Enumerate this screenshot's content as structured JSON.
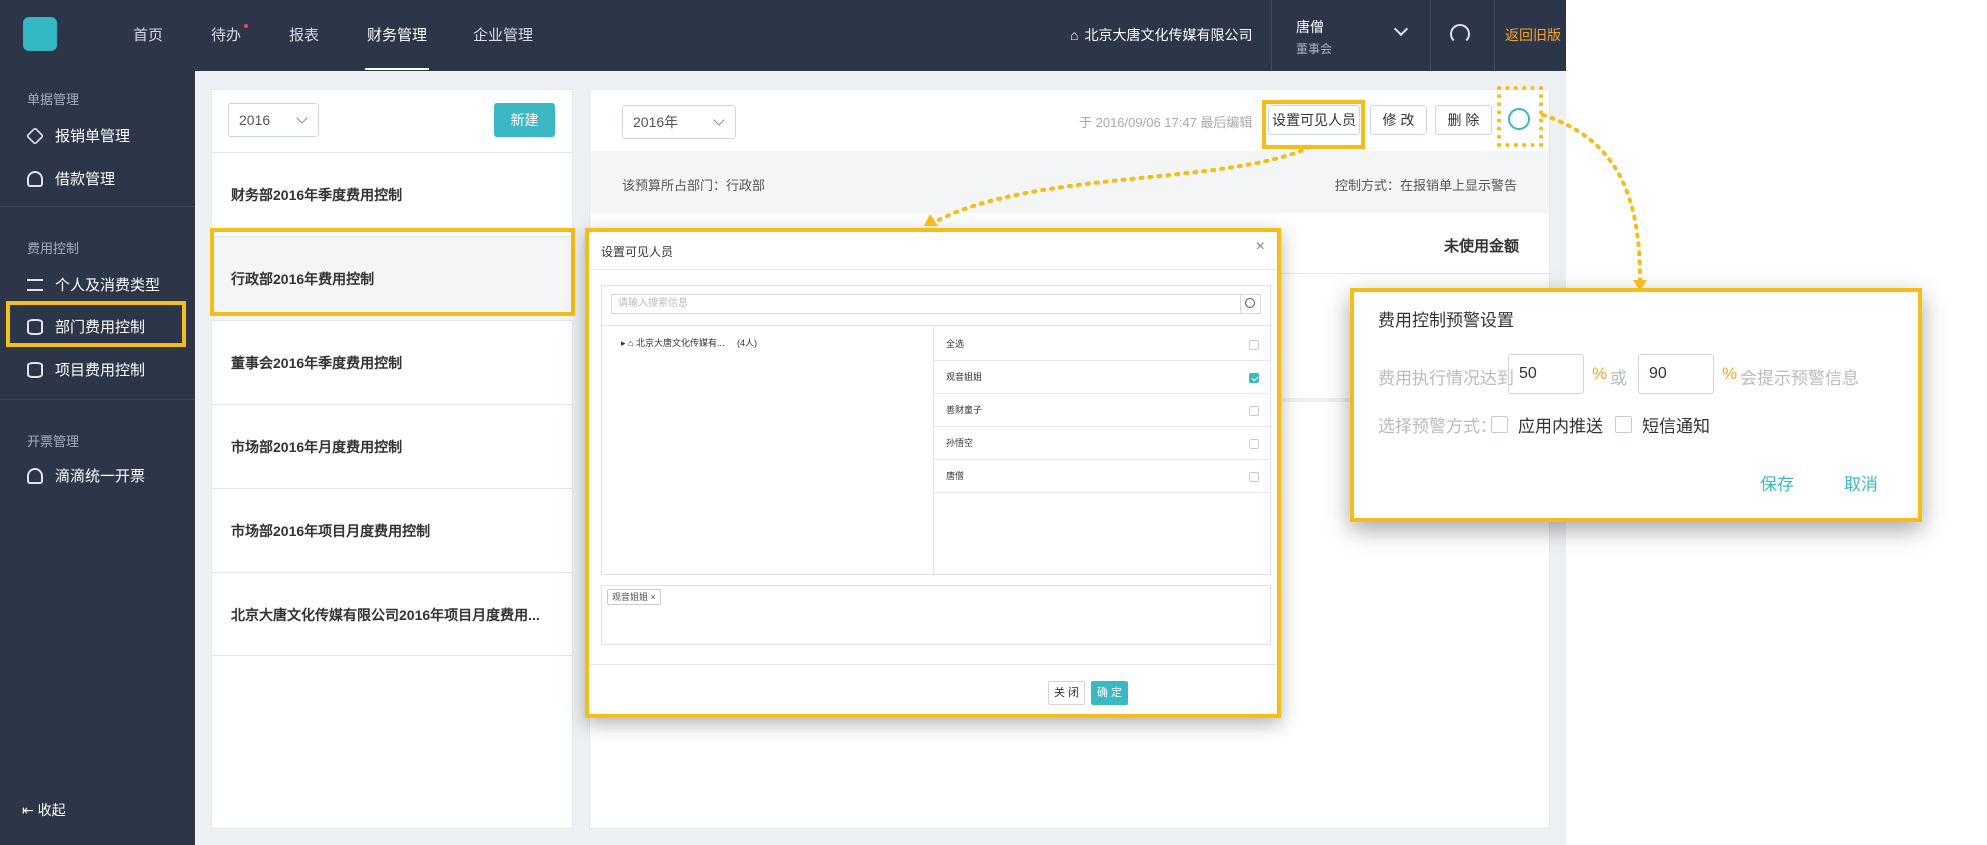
{
  "topbar": {
    "nav": [
      "首页",
      "待办",
      "报表",
      "财务管理",
      "企业管理"
    ],
    "active_nav": "财务管理",
    "company": "北京大唐文化传媒有限公司",
    "user_name": "唐僧",
    "user_role": "董事会",
    "back_old": "返回旧版"
  },
  "sidebar": {
    "sections": [
      {
        "title": "单据管理",
        "items": [
          "报销单管理",
          "借款管理"
        ]
      },
      {
        "title": "费用控制",
        "items": [
          "个人及消费类型",
          "部门费用控制",
          "项目费用控制"
        ]
      },
      {
        "title": "开票管理",
        "items": [
          "滴滴统一开票"
        ]
      }
    ],
    "active_item": "部门费用控制",
    "collapse_label": "收起"
  },
  "list": {
    "year": "2016",
    "new_label": "新建",
    "items": [
      "财务部2016年季度费用控制",
      "行政部2016年费用控制",
      "董事会2016年季度费用控制",
      "市场部2016年月度费用控制",
      "市场部2016年项目月度费用控制",
      "北京大唐文化传媒有限公司2016年项目月度费用..."
    ],
    "selected_index": 1
  },
  "detail": {
    "year": "2016年",
    "edit_info": "于 2016/09/06 17:47 最后编辑",
    "buttons": {
      "visible": "设置可见人员",
      "edit": "修 改",
      "delete": "删 除"
    },
    "dept_label": "该预算所占部门：行政部",
    "control_mode": "控制方式：在报销单上显示警告",
    "unused_amount": "未使用金额"
  },
  "dialog": {
    "title": "设置可见人员",
    "search_placeholder": "请输入搜索信息",
    "tree_node": "北京大唐文化传媒有...",
    "tree_count": "(4人)",
    "candidates": [
      {
        "name": "全选",
        "checked": false
      },
      {
        "name": "观音姐姐",
        "checked": true
      },
      {
        "name": "善财童子",
        "checked": false
      },
      {
        "name": "孙悟空",
        "checked": false
      },
      {
        "name": "唐僧",
        "checked": false
      }
    ],
    "selected_tag": "观音姐姐",
    "close_label": "关 闭",
    "confirm_label": "确 定"
  },
  "warning": {
    "title": "费用控制预警设置",
    "row_label": "费用执行情况达到",
    "value1": "50",
    "percent": "%",
    "or_label": "或",
    "value2": "90",
    "suffix": "会提示预警信息",
    "method_label": "选择预警方式：",
    "option_app": "应用内推送",
    "option_sms": "短信通知",
    "save_label": "保存",
    "cancel_label": "取消"
  },
  "colors": {
    "accent": "#3bb8c3",
    "highlight": "#f5bd17",
    "nav_bg": "#2c3648",
    "old_version": "#f2a530"
  }
}
